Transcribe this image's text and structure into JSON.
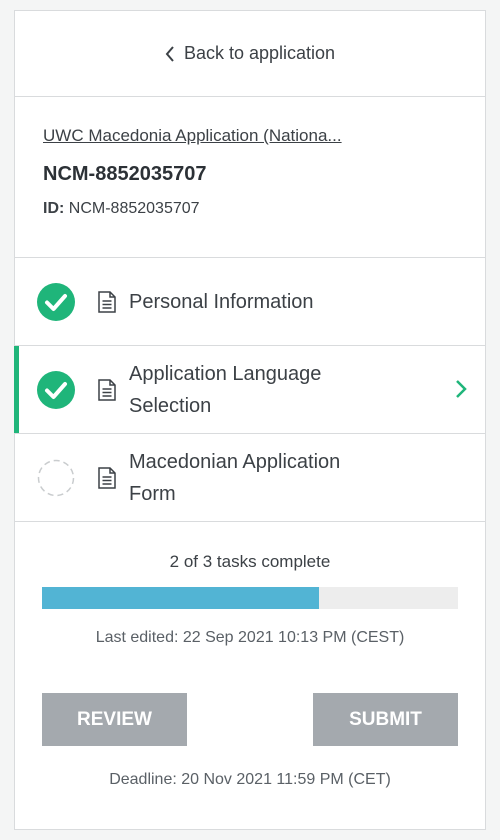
{
  "back": {
    "label": "Back to application"
  },
  "application": {
    "link_text": "UWC Macedonia Application (Nationa...",
    "code": "NCM-8852035707",
    "id_label": "ID:",
    "id_value": "NCM-8852035707"
  },
  "tasks": [
    {
      "label": "Personal Information",
      "status": "complete",
      "icon": "document-icon",
      "active": false
    },
    {
      "label": "Application Language Selection",
      "status": "complete",
      "icon": "document-icon",
      "active": true
    },
    {
      "label": "Macedonian Application Form",
      "status": "incomplete",
      "icon": "document-icon",
      "active": false
    }
  ],
  "progress": {
    "text": "2 of 3 tasks complete",
    "completed": 2,
    "total": 3,
    "fraction": 0.667
  },
  "last_edited": "Last edited: 22 Sep 2021 10:13 PM (CEST)",
  "buttons": {
    "review": "REVIEW",
    "submit": "SUBMIT"
  },
  "deadline": "Deadline: 20 Nov 2021 11:59 PM (CET)",
  "colors": {
    "accent": "#1fb57a",
    "progress": "#52b4d4",
    "button": "#a4a9ae",
    "check": "#1fb57a"
  }
}
